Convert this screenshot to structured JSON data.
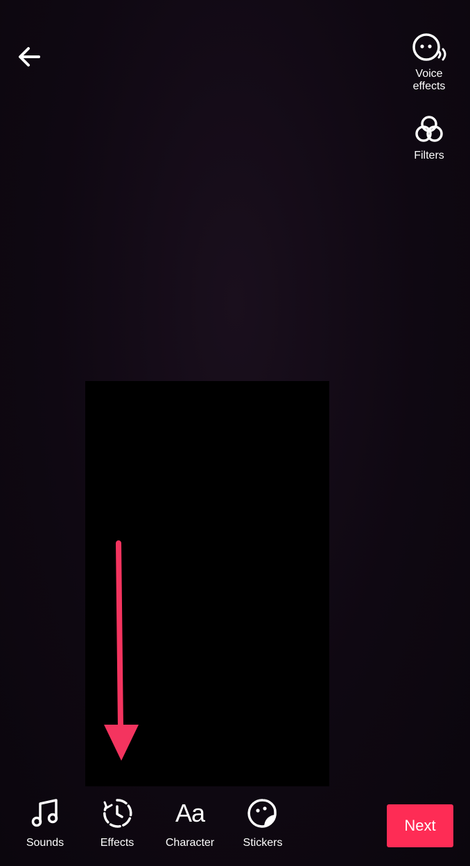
{
  "header": {
    "back_icon": "arrow-left-icon"
  },
  "side_tools": {
    "voice_effects": {
      "line1": "Voice",
      "line2": "effects",
      "icon": "voice-effects-icon"
    },
    "filters": {
      "label": "Filters",
      "icon": "filters-icon"
    }
  },
  "bottom_tools": {
    "sounds": {
      "label": "Sounds",
      "icon": "music-note-icon"
    },
    "effects": {
      "label": "Effects",
      "icon": "effects-timer-icon"
    },
    "character": {
      "label": "Character",
      "glyph": "Aa"
    },
    "stickers": {
      "label": "Stickers",
      "icon": "sticker-face-icon"
    }
  },
  "next_button": {
    "label": "Next"
  },
  "colors": {
    "accent": "#fe2c55",
    "background": "#0d0710",
    "preview": "#000000",
    "annotation_arrow": "#f4345f"
  }
}
